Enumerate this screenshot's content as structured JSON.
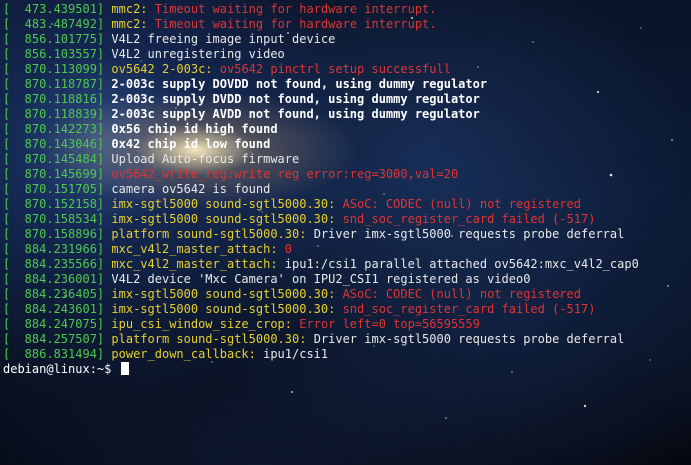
{
  "terminal": {
    "lines": [
      {
        "ts": "[  473.439501]",
        "source": "mmc2: ",
        "source_style": "yellow",
        "msg": "Timeout waiting for hardware interrupt.",
        "msg_style": "red"
      },
      {
        "ts": "[  483.487492]",
        "source": "mmc2: ",
        "source_style": "yellow",
        "msg": "Timeout waiting for hardware interrupt.",
        "msg_style": "red"
      },
      {
        "ts": "[  856.101775]",
        "source": "",
        "source_style": "white",
        "msg": "V4L2 freeing image input device",
        "msg_style": "white"
      },
      {
        "ts": "[  856.103557]",
        "source": "",
        "source_style": "white",
        "msg": "V4L2 unregistering video",
        "msg_style": "white"
      },
      {
        "ts": "[  870.113099]",
        "source": "ov5642 2-003c: ",
        "source_style": "yellow",
        "msg": "ov5642 pinctrl setup successfull",
        "msg_style": "red"
      },
      {
        "ts": "[  870.118787]",
        "source": "",
        "source_style": "white",
        "msg": "2-003c supply DOVDD not found, using dummy regulator",
        "msg_style": "bold"
      },
      {
        "ts": "[  870.118816]",
        "source": "",
        "source_style": "white",
        "msg": "2-003c supply DVDD not found, using dummy regulator",
        "msg_style": "bold"
      },
      {
        "ts": "[  870.118839]",
        "source": "",
        "source_style": "white",
        "msg": "2-003c supply AVDD not found, using dummy regulator",
        "msg_style": "bold"
      },
      {
        "ts": "[  870.142273]",
        "source": "",
        "source_style": "white",
        "msg": "0x56 chip id high found",
        "msg_style": "bold"
      },
      {
        "ts": "[  870.143046]",
        "source": "",
        "source_style": "white",
        "msg": "0x42 chip id low found",
        "msg_style": "bold"
      },
      {
        "ts": "[  870.145484]",
        "source": "",
        "source_style": "white",
        "msg": "Upload Auto-focus firmware",
        "msg_style": "white"
      },
      {
        "ts": "[  870.145699]",
        "source": "",
        "source_style": "white",
        "msg": "ov5642_write_reg:write reg error:reg=3000,val=20",
        "msg_style": "red"
      },
      {
        "ts": "[  870.151705]",
        "source": "",
        "source_style": "white",
        "msg": "camera ov5642 is found",
        "msg_style": "white"
      },
      {
        "ts": "[  870.152158]",
        "source": "imx-sgtl5000 sound-sgtl5000.30: ",
        "source_style": "yellow",
        "msg": "ASoC: CODEC (null) not registered",
        "msg_style": "red"
      },
      {
        "ts": "[  870.158534]",
        "source": "imx-sgtl5000 sound-sgtl5000.30: ",
        "source_style": "yellow",
        "msg": "snd_soc_register_card failed (-517)",
        "msg_style": "red"
      },
      {
        "ts": "[  870.158896]",
        "source": "platform sound-sgtl5000.30: ",
        "source_style": "yellow",
        "msg": "Driver imx-sgtl5000 requests probe deferral",
        "msg_style": "white"
      },
      {
        "ts": "[  884.231966]",
        "source": "mxc_v4l2_master_attach: ",
        "source_style": "yellow",
        "msg": "0",
        "msg_style": "red"
      },
      {
        "ts": "[  884.235566]",
        "source": "mxc_v4l2_master_attach: ",
        "source_style": "yellow",
        "msg": "ipu1:/csi1 parallel attached ov5642:mxc_v4l2_cap0",
        "msg_style": "white"
      },
      {
        "ts": "[  884.236001]",
        "source": "",
        "source_style": "white",
        "msg": "V4L2 device 'Mxc Camera' on IPU2_CSI1 registered as video0",
        "msg_style": "white"
      },
      {
        "ts": "[  884.236405]",
        "source": "imx-sgtl5000 sound-sgtl5000.30: ",
        "source_style": "yellow",
        "msg": "ASoC: CODEC (null) not registered",
        "msg_style": "red"
      },
      {
        "ts": "[  884.243601]",
        "source": "imx-sgtl5000 sound-sgtl5000.30: ",
        "source_style": "yellow",
        "msg": "snd_soc_register_card failed (-517)",
        "msg_style": "red"
      },
      {
        "ts": "[  884.247075]",
        "source": "ipu_csi_window_size_crop: ",
        "source_style": "yellow",
        "msg": "Error left=0 top=56595559",
        "msg_style": "red"
      },
      {
        "ts": "[  884.257507]",
        "source": "platform sound-sgtl5000.30: ",
        "source_style": "yellow",
        "msg": "Driver imx-sgtl5000 requests probe deferral",
        "msg_style": "white"
      },
      {
        "ts": "[  886.831494]",
        "source": "power_down_callback: ",
        "source_style": "yellow",
        "msg": "ipu1/csi1",
        "msg_style": "white"
      }
    ],
    "prompt": "debian@linux:~$ "
  },
  "colors": {
    "timestamp": "#4ec94e",
    "source": "#e7cf2e",
    "error": "#e03434",
    "text": "#e9e9e9"
  }
}
